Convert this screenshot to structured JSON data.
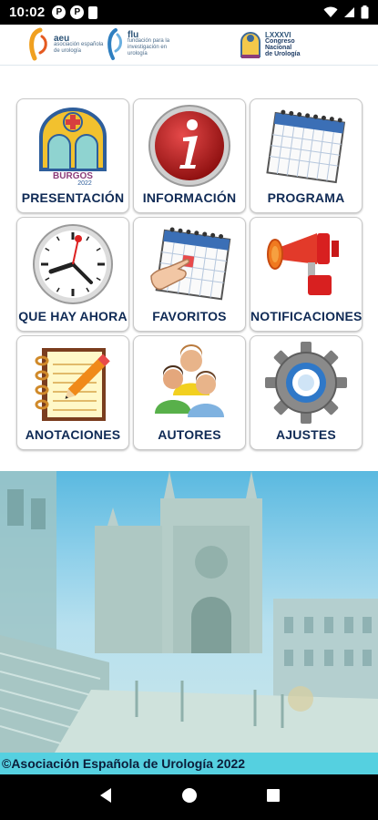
{
  "status_bar": {
    "time": "10:02",
    "icon_letter_1": "P",
    "icon_letter_2": "P"
  },
  "header": {
    "logo_aeu": {
      "name": "aeu",
      "sub": "asociación española de urología"
    },
    "logo_flu": {
      "name": "flu",
      "sub": "fundación para la investigación en urología"
    },
    "logo_congress": {
      "roman": "LXXXVI",
      "line1": "Congreso",
      "line2": "Nacional",
      "line3": "de Urología"
    }
  },
  "menu": [
    {
      "label": "PRESENTACIÓN",
      "icon": "burgos-logo-icon"
    },
    {
      "label": "INFORMACIÓN",
      "icon": "info-icon"
    },
    {
      "label": "PROGRAMA",
      "icon": "calendar-icon"
    },
    {
      "label": "QUE HAY AHORA",
      "icon": "clock-icon"
    },
    {
      "label": "FAVORITOS",
      "icon": "calendar-hand-icon"
    },
    {
      "label": "NOTIFICACIONES",
      "icon": "megaphone-icon"
    },
    {
      "label": "ANOTACIONES",
      "icon": "notepad-icon"
    },
    {
      "label": "AUTORES",
      "icon": "people-icon"
    },
    {
      "label": "AJUSTES",
      "icon": "gear-icon"
    }
  ],
  "burgos_logo": {
    "text": "BURGOS",
    "year": "2022"
  },
  "footer": {
    "copyright": "©Asociación Española de Urología 2022"
  },
  "colors": {
    "label": "#0f2a55",
    "footer_bar": "#55d0e0"
  }
}
